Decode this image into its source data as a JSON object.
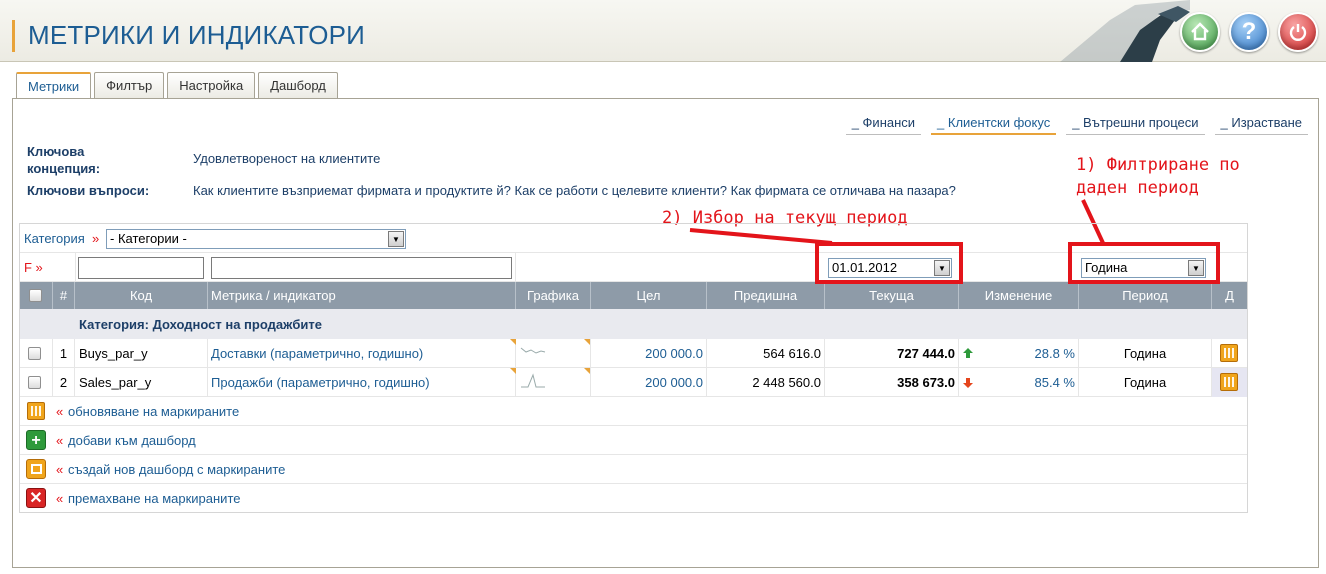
{
  "app": {
    "title": "МЕТРИКИ И ИНДИКАТОРИ"
  },
  "tabs": [
    {
      "label": "Метрики"
    },
    {
      "label": "Филтър"
    },
    {
      "label": "Настройка"
    },
    {
      "label": "Дашборд"
    }
  ],
  "categories": [
    "_ Финанси",
    "_ Клиентски фокус",
    "_ Вътрешни процеси",
    "_ Израстване"
  ],
  "key_concept": {
    "label": "Ключова концепция:",
    "value": "Удовлетвореност на клиентите"
  },
  "key_questions": {
    "label": "Ключови въпроси:",
    "value": "Как клиентите възприемат фирмата и продуктите й? Как се работи с целевите клиенти? Как фирмата се отличава на пазара?"
  },
  "annotations": {
    "filter_period": "1) Филтриране по даден период",
    "current_period": "2) Избор на текущ период"
  },
  "filter": {
    "category_label": "Категория",
    "category_arrow": "»",
    "category_value": "- Категории -",
    "f_label": "F »",
    "date_value": "01.01.2012",
    "period_value": "Година"
  },
  "table": {
    "headers": {
      "num": "#",
      "code": "Код",
      "metric": "Метрика / индикатор",
      "chart": "Графика",
      "goal": "Цел",
      "previous": "Предишна",
      "current": "Текуща",
      "change": "Изменение",
      "period": "Период",
      "d": "Д"
    },
    "group": "Категория: Доходност на продажбите",
    "rows": [
      {
        "num": "1",
        "code": "Buys_par_y",
        "metric": "Доставки (параметрично, годишно)",
        "goal": "200 000.0",
        "previous": "564 616.0",
        "current": "727 444.0",
        "trend": "up",
        "change": "28.8 %",
        "period": "Година"
      },
      {
        "num": "2",
        "code": "Sales_par_y",
        "metric": "Продажби (параметрично, годишно)",
        "goal": "200 000.0",
        "previous": "2 448 560.0",
        "current": "358 673.0",
        "trend": "down",
        "change": "85.4 %",
        "period": "Година"
      }
    ]
  },
  "actions": [
    {
      "prefix": "«",
      "label": "обновяване на маркираните",
      "icon": "calculator-icon"
    },
    {
      "prefix": "«",
      "label": "добави към дашборд",
      "icon": "add-icon"
    },
    {
      "prefix": "«",
      "label": "създай нов дашборд с маркираните",
      "icon": "new-dashboard-icon"
    },
    {
      "prefix": "«",
      "label": "премахване на маркираните",
      "icon": "delete-icon"
    }
  ],
  "colors": {
    "title": "#1d5d93",
    "accent": "#e8a33a",
    "annotation": "#e3141a",
    "header_bg": "#8e9ba8",
    "trend_up": "#2e9a3b",
    "trend_down": "#e5461d"
  }
}
